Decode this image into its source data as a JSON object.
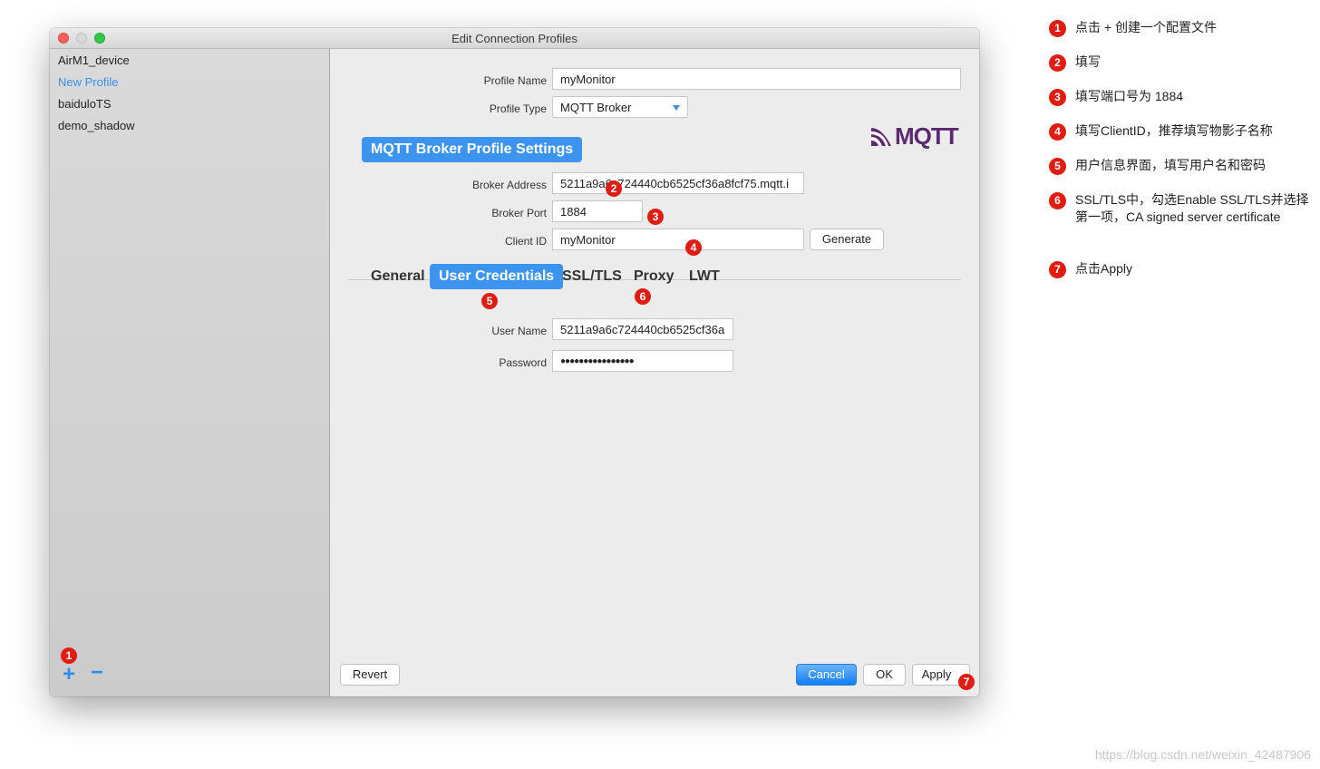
{
  "window": {
    "title": "Edit Connection Profiles"
  },
  "sidebar": {
    "items": [
      {
        "label": "AirM1_device",
        "selected": false
      },
      {
        "label": "New Profile",
        "selected": true
      },
      {
        "label": "baiduloTS",
        "selected": false
      },
      {
        "label": "demo_shadow",
        "selected": false
      }
    ],
    "add_label": "+",
    "remove_label": "−"
  },
  "profile": {
    "name_label": "Profile Name",
    "name_value": "myMonitor",
    "type_label": "Profile Type",
    "type_value": "MQTT Broker",
    "logo_text": "MQTT"
  },
  "broker": {
    "section_title": "MQTT Broker Profile Settings",
    "address_label": "Broker Address",
    "address_value": "5211a9a6c724440cb6525cf36a8fcf75.mqtt.i",
    "port_label": "Broker Port",
    "port_value": "1884",
    "client_label": "Client ID",
    "client_value": "myMonitor",
    "generate_label": "Generate"
  },
  "tabs": [
    {
      "label": "General",
      "active": false
    },
    {
      "label": "User Credentials",
      "active": true
    },
    {
      "label": "SSL/TLS",
      "active": false
    },
    {
      "label": "Proxy",
      "active": false
    },
    {
      "label": "LWT",
      "active": false
    }
  ],
  "credentials": {
    "user_label": "User Name",
    "user_value": "5211a9a6c724440cb6525cf36a",
    "password_label": "Password",
    "password_value": "●●●●●●●●●●●●●●●●"
  },
  "footer": {
    "revert_label": "Revert",
    "cancel_label": "Cancel",
    "ok_label": "OK",
    "apply_label": "Apply"
  },
  "badges": [
    "1",
    "2",
    "3",
    "4",
    "5",
    "6",
    "7"
  ],
  "annotations": [
    {
      "num": "1",
      "text": "点击 + 创建一个配置文件"
    },
    {
      "num": "2",
      "text": "填写"
    },
    {
      "num": "3",
      "text": "填写端口号为 1884"
    },
    {
      "num": "4",
      "text": "填写ClientID，推荐填写物影子名称"
    },
    {
      "num": "5",
      "text": "用户信息界面，填写用户名和密码"
    },
    {
      "num": "6",
      "text": "SSL/TLS中，勾选Enable SSL/TLS并选择 第一项，CA signed server certificate"
    },
    {
      "num": "7",
      "text": "点击Apply"
    }
  ],
  "watermark": "https://blog.csdn.net/weixin_42487906",
  "colors": {
    "accent": "#3d94f0",
    "badge": "#e01d12",
    "logo": "#5b2a6e"
  }
}
